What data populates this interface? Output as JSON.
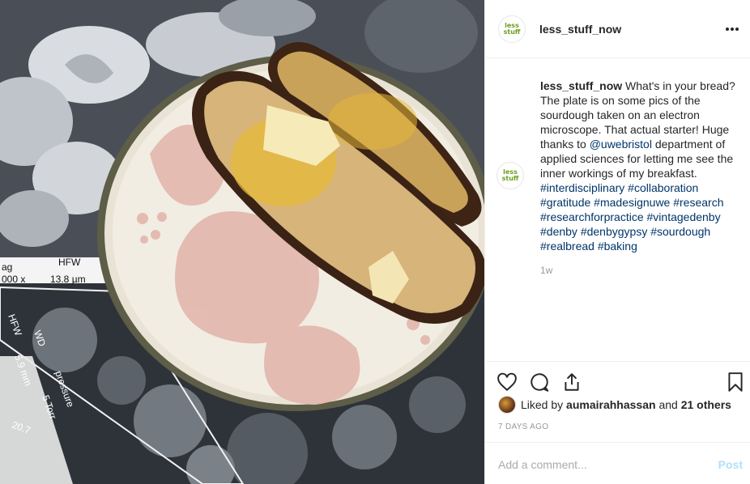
{
  "post": {
    "username": "less_stuff_now",
    "avatar_logo_top": "less",
    "avatar_logo_bottom": "stuff",
    "caption_parts": [
      "What's in your bread? The plate is on some pics of the sourdough taken on an electron microscope. That actual starter! Huge thanks to ",
      "@uwebristol",
      " department of applied sciences for letting me see the inner workings of my breakfast. "
    ],
    "hashtags": [
      "#interdisciplinary",
      "#collaboration",
      "#gratitude",
      "#madesignuwe",
      "#research",
      "#researchforpractice",
      "#vintagedenby",
      "#denby",
      "#denbygypsy",
      "#sourdough",
      "#realbread",
      "#baking"
    ],
    "time_ago": "1w",
    "liked_by_prefix": "Liked by",
    "liked_by_user": "aumairahhassan",
    "liked_by_and": "and",
    "liked_by_others": "21 others",
    "date": "7 DAYS AGO",
    "comment_placeholder": "Add a comment...",
    "post_label": "Post"
  },
  "photo": {
    "sem_labels": [
      "ag",
      "HFW",
      "000 x",
      "13.8 µm",
      "HFW",
      "WD",
      "5.9 mm",
      "pressure",
      "5 Torr",
      "20.7"
    ]
  },
  "icons": [
    "more-icon",
    "heart-icon",
    "comment-icon",
    "share-icon",
    "bookmark-icon"
  ],
  "colors": {
    "link": "#003569",
    "muted": "#999999",
    "post_disabled": "#b2dffc",
    "brand_green": "#6a9e1f"
  }
}
